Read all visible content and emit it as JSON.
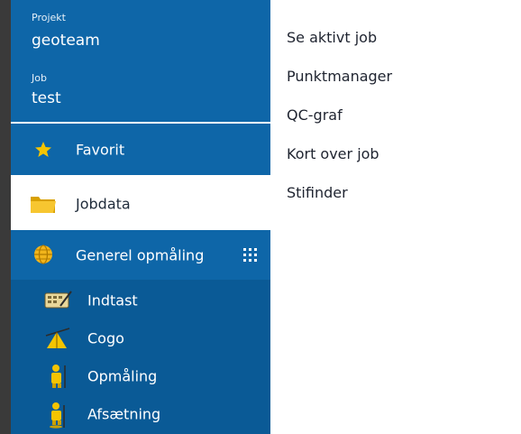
{
  "sidebar": {
    "project_label": "Projekt",
    "project_value": "geoteam",
    "job_label": "Job",
    "job_value": "test",
    "items": [
      {
        "label": "Favorit",
        "icon": "star-icon"
      },
      {
        "label": "Jobdata",
        "icon": "folder-icon"
      },
      {
        "label": "Generel opmåling",
        "icon": "globe-icon"
      }
    ],
    "subitems": [
      {
        "label": "Indtast",
        "icon": "keypad-pencil-icon"
      },
      {
        "label": "Cogo",
        "icon": "cogo-icon"
      },
      {
        "label": "Opmåling",
        "icon": "surveyor-icon"
      },
      {
        "label": "Afsætning",
        "icon": "stakeout-icon"
      }
    ]
  },
  "right_menu": {
    "items": [
      "Se aktivt job",
      "Punktmanager",
      "QC-graf",
      "Kort over job",
      "Stifinder"
    ]
  },
  "colors": {
    "sidebar_blue": "#0e66a8",
    "submenu_blue": "#0a5a96",
    "icon_yellow": "#f5c400"
  }
}
